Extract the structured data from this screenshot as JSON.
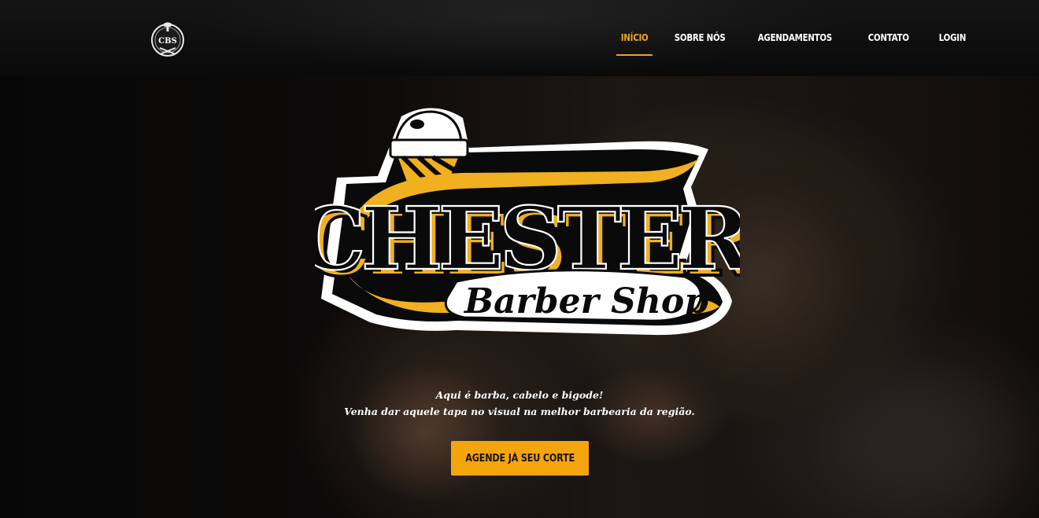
{
  "nav": {
    "logo_text": "CBS",
    "items": [
      {
        "label": "INÍCIO",
        "active": true
      },
      {
        "label": "SOBRE NÓS",
        "active": false
      },
      {
        "label": "AGENDAMENTOS",
        "active": false
      },
      {
        "label": "CONTATO",
        "active": false
      },
      {
        "label": "LOGIN",
        "active": false
      }
    ]
  },
  "hero": {
    "logo_title": "CHESTER",
    "logo_subtitle": "Barber Shop",
    "tagline_line1": "Aqui é barba, cabelo e bigode!",
    "tagline_line2": "Venha dar aquele tapa no visual na melhor barbearia da região.",
    "cta_label": "AGENDE JÁ SEU CORTE"
  },
  "colors": {
    "accent": "#f5a50c",
    "nav_active": "#f0a21a",
    "background": "#0b0a09",
    "text": "#ffffff"
  }
}
